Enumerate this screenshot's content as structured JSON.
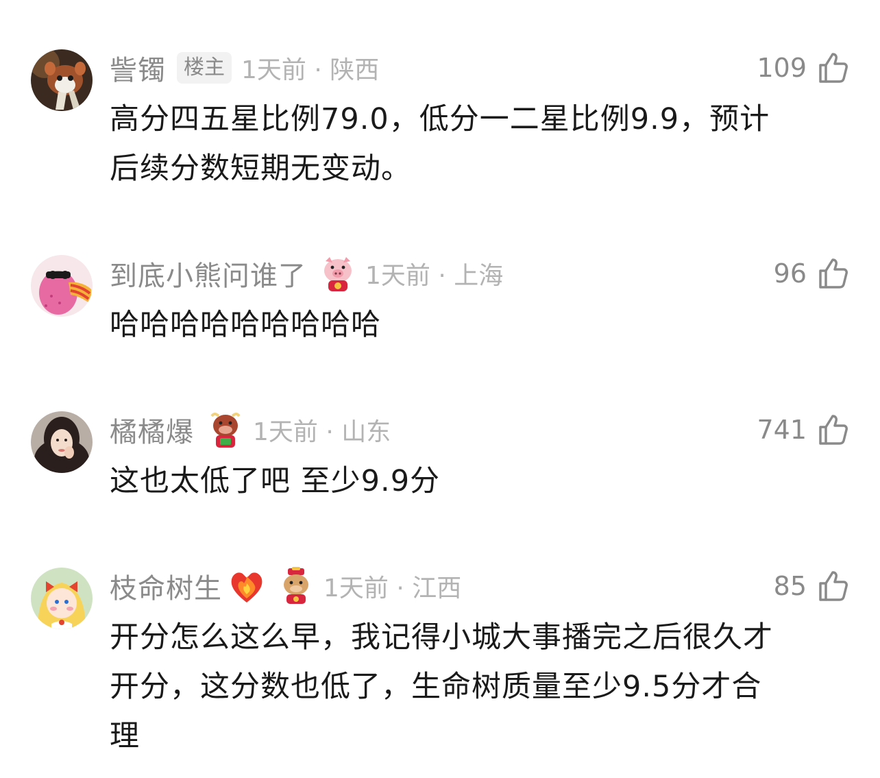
{
  "comments": [
    {
      "username": "訾镯",
      "owner_badge": "楼主",
      "time_location": "1天前 · 陕西",
      "likes": "109",
      "content_lines": [
        "高分四五星比例79.0，低分一二星比例9.9，预计",
        "后续分数短期无变动。"
      ]
    },
    {
      "username": "到底小熊问谁了",
      "badge_icon": "pig-fortune-icon",
      "time_location": "1天前 · 上海",
      "likes": "96",
      "content_lines": [
        "哈哈哈哈哈哈哈哈哈"
      ]
    },
    {
      "username": "橘橘爆",
      "badge_icon": "ox-fortune-icon",
      "time_location": "1天前 · 山东",
      "likes": "741",
      "content_lines": [
        "这也太低了吧 至少9.9分"
      ]
    },
    {
      "username": "枝命树生",
      "badge_icon": "ox-wealth-god-icon",
      "heart_icon": "fire-heart-icon",
      "time_location": "1天前 · 江西",
      "likes": "85",
      "content_lines": [
        "开分怎么这么早，我记得小城大事播完之后很久才",
        "开分，这分数也低了，生命树质量至少9.5分才合",
        "理"
      ]
    }
  ],
  "colors": {
    "meta_gray": "#8a8a8a",
    "time_gray": "#b3b3b3",
    "text": "#1a1a1a",
    "background": "#ffffff"
  }
}
